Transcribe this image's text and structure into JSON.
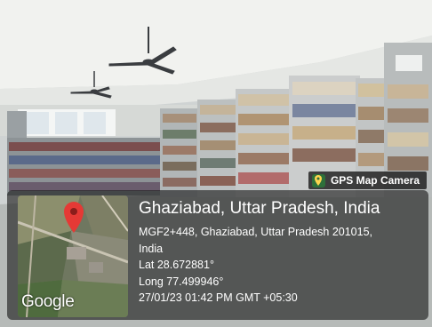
{
  "camera_badge": {
    "label": "GPS Map Camera",
    "icon": "map-pin-icon",
    "accent": "#2e6f3a"
  },
  "map": {
    "watermark": "Google",
    "marker_color": "#e53935"
  },
  "location": {
    "title": "Ghaziabad, Uttar Pradesh, India",
    "address_line1": "MGF2+448, Ghaziabad, Uttar Pradesh 201015,",
    "address_line2": "India",
    "latitude": "Lat 28.672881°",
    "longitude": "Long 77.499946°",
    "datetime": "27/01/23 01:42 PM GMT +05:30"
  }
}
